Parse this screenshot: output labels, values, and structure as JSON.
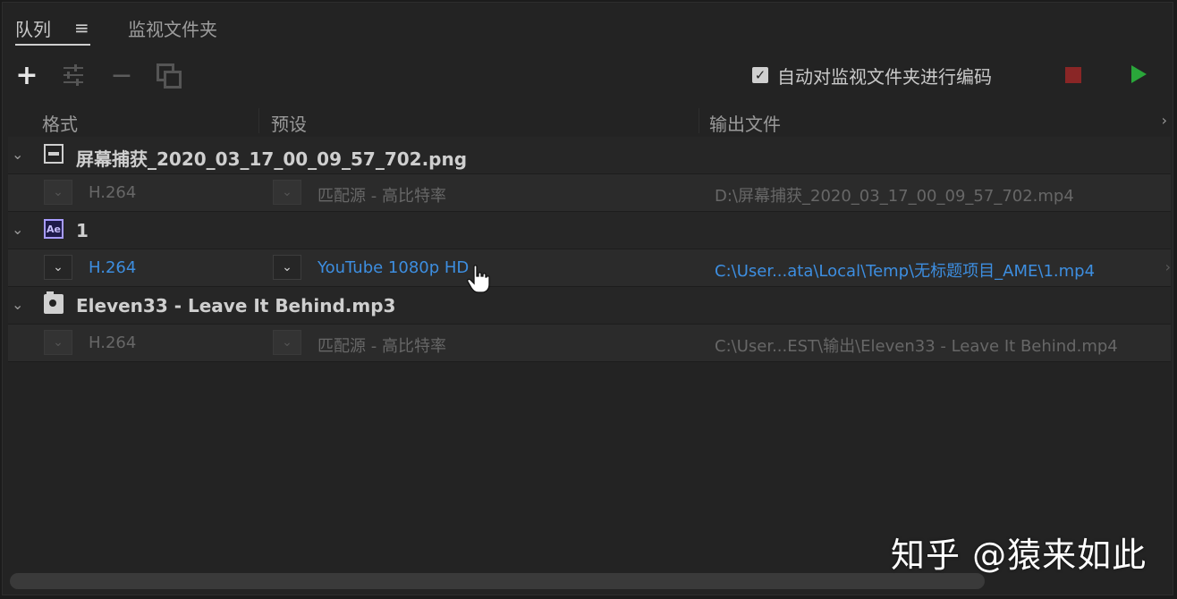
{
  "tabs": {
    "queue_label": "队列",
    "queue_menu_icon": "hamburger-menu-icon",
    "watch_label": "监视文件夹"
  },
  "toolbar": {
    "add_icon": "plus-icon",
    "settings_icon": "settings-sliders-icon",
    "remove_icon": "minus-icon",
    "duplicate_icon": "duplicate-icon",
    "auto_encode_checked": true,
    "auto_encode_label": "自动对监视文件夹进行编码",
    "stop_icon": "stop-icon",
    "start_icon": "play-icon",
    "stop_color": "#8a2626",
    "start_color": "#2aa63a"
  },
  "columns": {
    "format": "格式",
    "preset": "预设",
    "output": "输出文件",
    "more": "›"
  },
  "queue": [
    {
      "source_name": "屏幕捕获_2020_03_17_00_09_57_702.png",
      "source_icon": "image-file-icon",
      "format": "H.264",
      "preset": "匹配源 - 高比特率",
      "output": "D:\\屏幕捕获_2020_03_17_00_09_57_702.mp4",
      "active": false
    },
    {
      "source_name": "1",
      "source_icon": "after-effects-icon",
      "source_icon_text": "Ae",
      "format": "H.264",
      "preset": "YouTube 1080p HD",
      "output": "C:\\User...ata\\Local\\Temp\\无标题项目_AME\\1.mp4",
      "active": true
    },
    {
      "source_name": "Eleven33 - Leave It Behind.mp3",
      "source_icon": "audio-file-icon",
      "format": "H.264",
      "preset": "匹配源 - 高比特率",
      "output": "C:\\User...EST\\输出\\Eleven33 - Leave It Behind.mp4",
      "active": false
    }
  ],
  "accent_blue": "#3d8ee0",
  "watermark": "知乎 @猿来如此"
}
